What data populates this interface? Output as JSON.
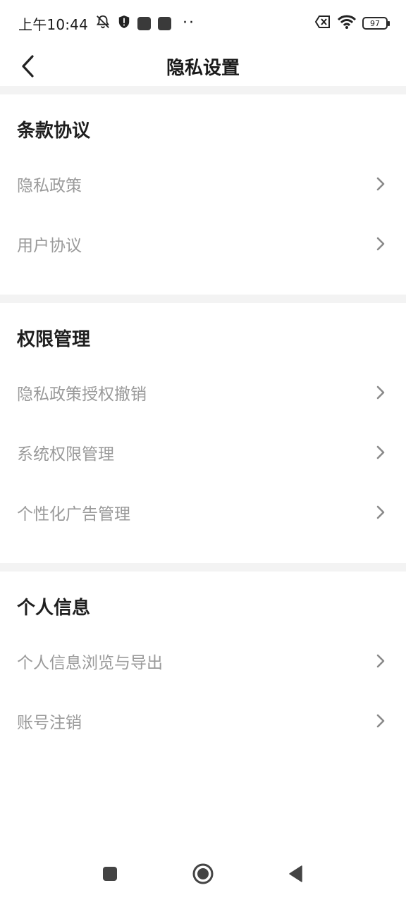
{
  "status_bar": {
    "time": "上午10:44",
    "dots": "··",
    "battery": "97"
  },
  "header": {
    "title": "隐私设置"
  },
  "sections": [
    {
      "title": "条款协议",
      "items": [
        {
          "label": "隐私政策"
        },
        {
          "label": "用户协议"
        }
      ]
    },
    {
      "title": "权限管理",
      "items": [
        {
          "label": "隐私政策授权撤销"
        },
        {
          "label": "系统权限管理"
        },
        {
          "label": "个性化广告管理"
        }
      ]
    },
    {
      "title": "个人信息",
      "items": [
        {
          "label": "个人信息浏览与导出"
        },
        {
          "label": "账号注销"
        }
      ]
    }
  ],
  "nav_bar": {
    "icons": [
      "recents-icon",
      "home-icon",
      "back-icon"
    ]
  }
}
